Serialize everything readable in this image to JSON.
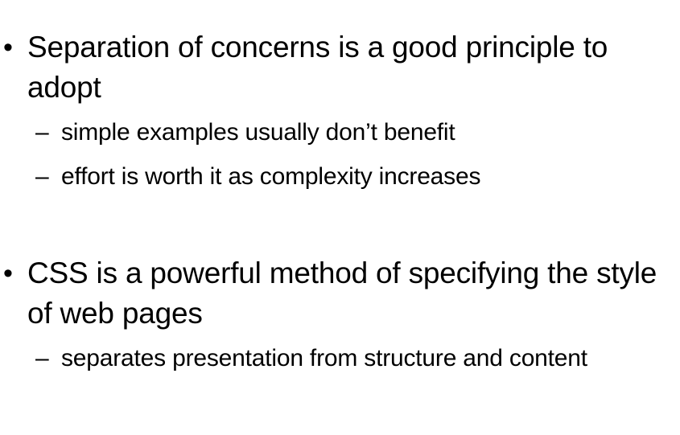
{
  "slide": {
    "bullet_symbol": "•",
    "dash_symbol": "–",
    "points": [
      {
        "text": "Separation of concerns is a good principle to adopt",
        "subpoints": [
          "simple examples usually don’t benefit",
          "effort is worth it as complexity increases"
        ]
      },
      {
        "text": "CSS is a powerful method of specifying the style of web pages",
        "subpoints": [
          "separates presentation from structure and content"
        ]
      }
    ]
  }
}
